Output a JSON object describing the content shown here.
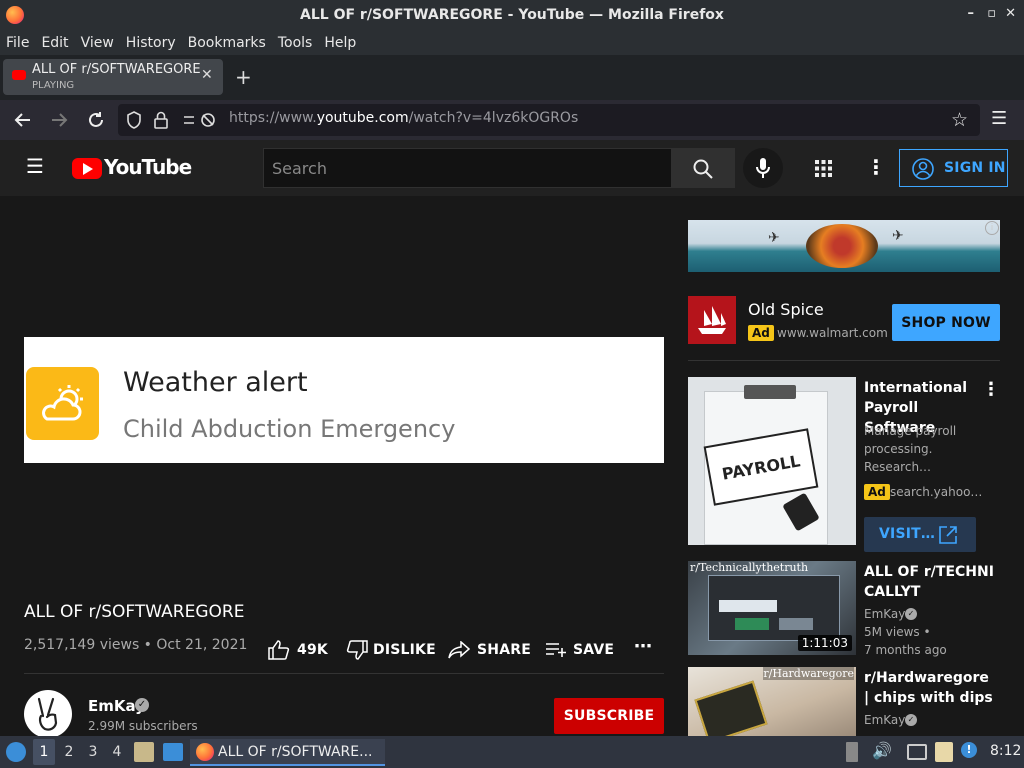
{
  "window": {
    "title": "ALL OF r/SOFTWAREGORE - YouTube — Mozilla Firefox",
    "controls": [
      "–",
      "▫",
      "✕"
    ]
  },
  "menu": [
    "File",
    "Edit",
    "View",
    "History",
    "Bookmarks",
    "Tools",
    "Help"
  ],
  "tab": {
    "title": "ALL OF r/SOFTWAREGORE - YouTube",
    "status": "PLAYING"
  },
  "url": {
    "prefix": "https://www.",
    "domain": "youtube.com",
    "path": "/watch?v=4lvz6kOGROs"
  },
  "header": {
    "logo": "YouTube",
    "search_placeholder": "Search",
    "sign_in": "SIGN IN"
  },
  "video": {
    "overlay_title": "Weather alert",
    "overlay_subtitle": "Child Abduction Emergency",
    "title": "ALL OF r/SOFTWAREGORE",
    "meta": "2,517,149 views • Oct 21, 2021",
    "likes": "49K",
    "dislike": "DISLIKE",
    "share": "SHARE",
    "save": "SAVE"
  },
  "channel": {
    "name": "EmKay",
    "subscribers": "2.99M subscribers",
    "subscribe": "SUBSCRIBE"
  },
  "ad": {
    "brand": "Old Spice",
    "ad_label": "Ad",
    "url": "www.walmart.com",
    "cta": "SHOP NOW"
  },
  "sidebar": {
    "ad_item": {
      "title": "International Payroll Software",
      "desc": "Manage payroll processing. Research…",
      "ad_label": "Ad",
      "url": "search.yahoo…",
      "cta": "VISIT…",
      "thumb_text": "PAYROLL"
    },
    "videos": [
      {
        "title": "ALL OF r/TECHNICALLYT",
        "channel": "EmKay",
        "views": "5M views •",
        "age": "7 months ago",
        "duration": "1:11:03",
        "thumb_label": "r/Technicallythetruth"
      },
      {
        "title": "r/Hardwaregore | chips with dips",
        "channel": "EmKay",
        "thumb_label": "r/Hardwaregore"
      }
    ]
  },
  "taskbar": {
    "workspaces": [
      "1",
      "2",
      "3",
      "4"
    ],
    "active_window": "ALL OF r/SOFTWARE...",
    "clock": "8:12"
  },
  "colors": {
    "yt_red": "#ff0000",
    "subscribe_red": "#cc0000",
    "blue_cta": "#3ea6ff",
    "ad_yellow": "#f5c518"
  }
}
